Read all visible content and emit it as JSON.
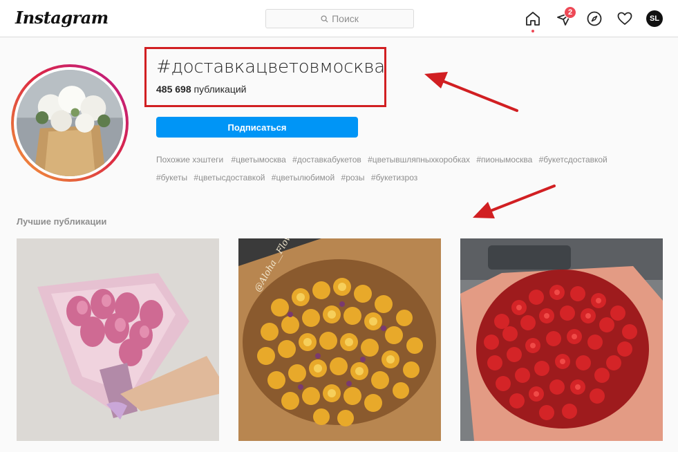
{
  "header": {
    "logo": "Instagram",
    "search_placeholder": "Поиск",
    "icons": [
      "home-icon",
      "direct-icon",
      "explore-icon",
      "activity-icon"
    ],
    "direct_badge": "2",
    "user_initials": "SL"
  },
  "hashtag": {
    "title": "#доставкацветовмосква",
    "posts_count": "485 698",
    "posts_label": "публикаций",
    "follow_label": "Подписаться",
    "related_label": "Похожие хэштеги",
    "related_tags": [
      "#цветымосква",
      "#доставкабукетов",
      "#цветывшляпныхкоробках",
      "#пионымосква",
      "#букетсдоставкой",
      "#букеты",
      "#цветысдоставкой",
      "#цветылюбимой",
      "#розы",
      "#букетизроз"
    ]
  },
  "top_posts": {
    "title": "Лучшие публикации",
    "posts": [
      {
        "name": "pink-tulips-bouquet"
      },
      {
        "name": "yellow-roses-bouquet",
        "watermark": "@Aloha__Flowers"
      },
      {
        "name": "red-roses-bouquet"
      }
    ]
  },
  "colors": {
    "accent": "#0095f6",
    "annotation_red": "#d11f22",
    "badge": "#ed4956"
  }
}
